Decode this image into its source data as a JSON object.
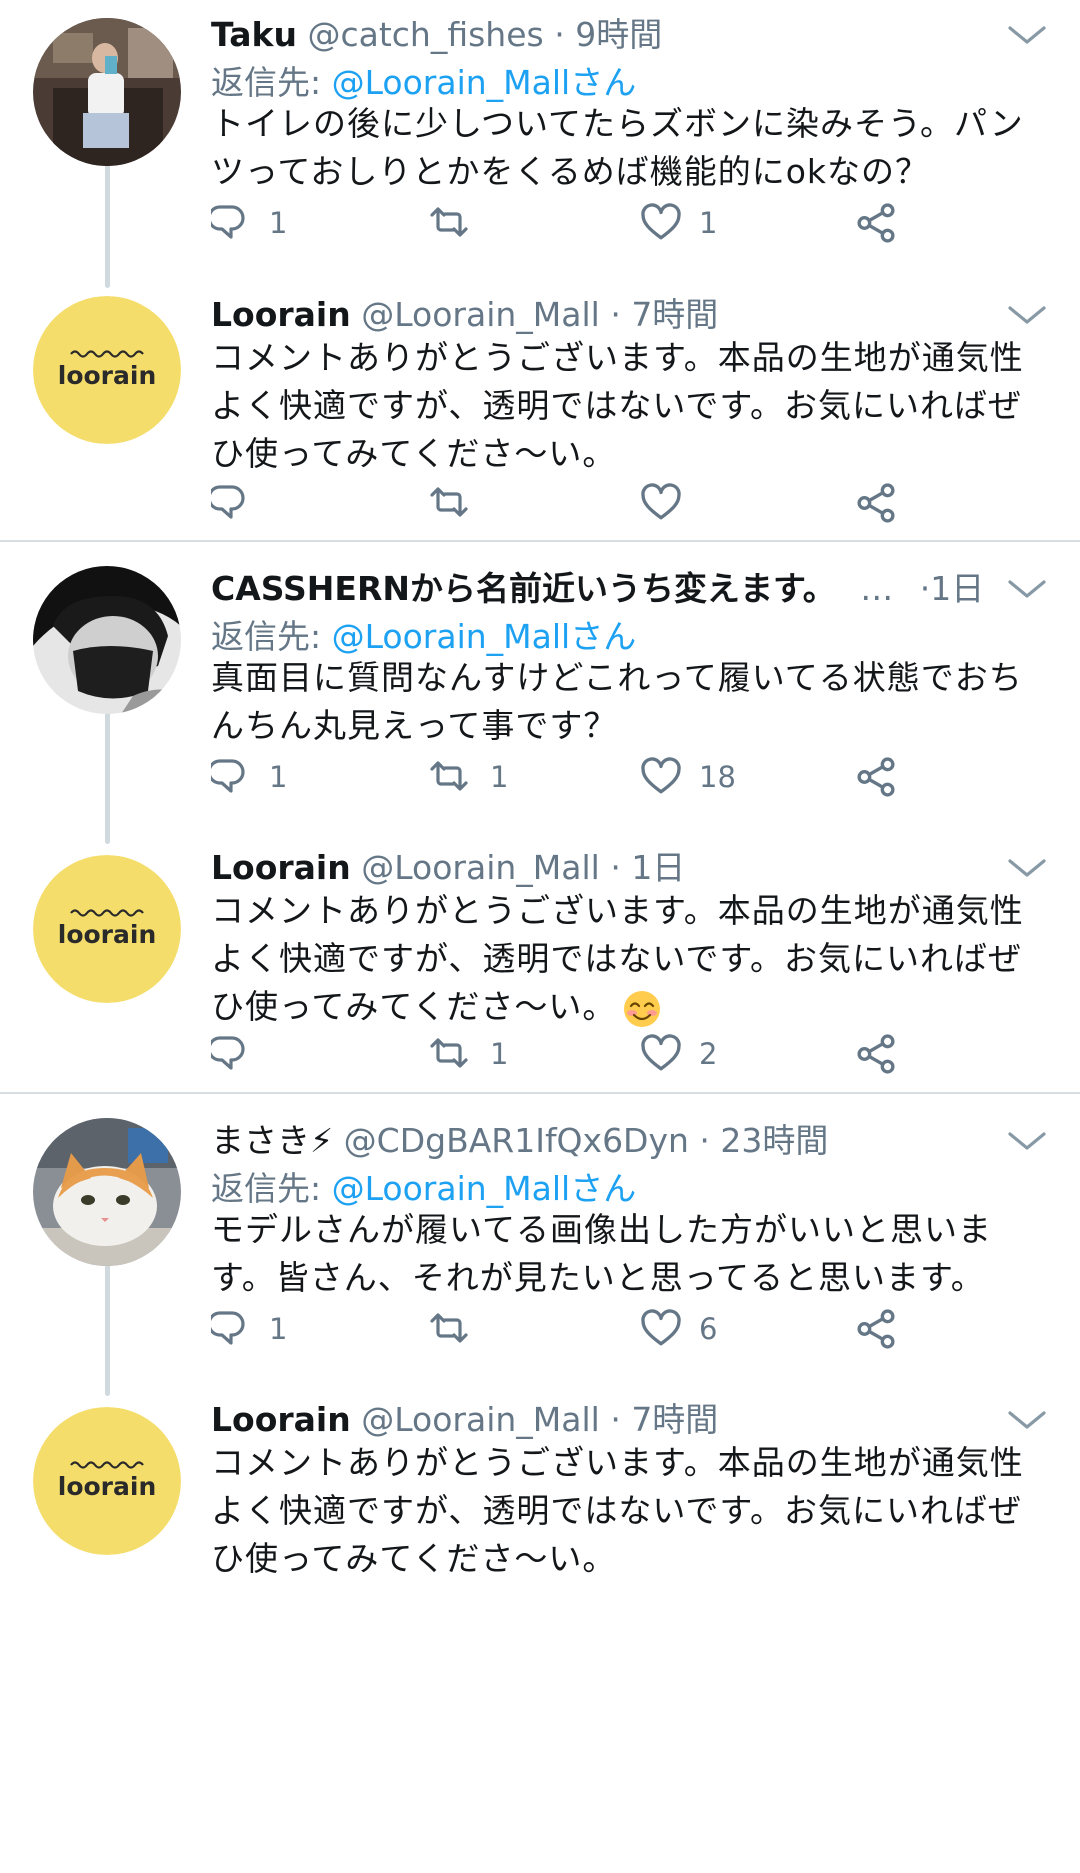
{
  "threads": [
    {
      "parent": {
        "name": "Taku",
        "handle": "@catch_fishes",
        "time": "9時間",
        "reply_label": "返信先: ",
        "reply_mention": "@Loorain_Mallさん",
        "text": "トイレの後に少しついてたらズボンに染みそう。パンツっておしりとかをくるめば機能的にokなの？",
        "reply_count": "1",
        "retweet_count": "",
        "like_count": "1"
      },
      "reply": {
        "name": "Loorain",
        "handle": "@Loorain_Mall",
        "time": "7時間",
        "text": "コメントありがとうございます。本品の生地が通気性よく快適ですが、透明ではないです。お気にいればぜひ使ってみてくださ〜い。",
        "reply_count": "",
        "retweet_count": "",
        "like_count": ""
      }
    },
    {
      "parent": {
        "name": "CASSHERNから名前近いうち変えます。",
        "ellipsis": "…",
        "time": "1日",
        "reply_label": "返信先: ",
        "reply_mention": "@Loorain_Mallさん",
        "text": "真面目に質問なんすけどこれって履いてる状態でおちんちん丸見えって事です？",
        "reply_count": "1",
        "retweet_count": "1",
        "like_count": "18"
      },
      "reply": {
        "name": "Loorain",
        "handle": "@Loorain_Mall",
        "time": "1日",
        "text": "コメントありがとうございます。本品の生地が通気性よく快適ですが、透明ではないです。お気にいればぜひ使ってみてくださ〜い。",
        "reply_count": "",
        "retweet_count": "1",
        "like_count": "2"
      }
    },
    {
      "parent": {
        "name": "まさき⚡",
        "handle": "@CDgBAR1IfQx6Dyn",
        "time": "23時間",
        "reply_label": "返信先: ",
        "reply_mention": "@Loorain_Mallさん",
        "text": "モデルさんが履いてる画像出した方がいいと思います。皆さん、それが見たいと思ってると思います。",
        "reply_count": "1",
        "retweet_count": "",
        "like_count": "6"
      },
      "reply": {
        "name": "Loorain",
        "handle": "@Loorain_Mall",
        "time": "7時間",
        "text": "コメントありがとうございます。本品の生地が通気性よく快適ですが、透明ではないです。お気にいればぜひ使ってみてくださ〜い。"
      }
    }
  ],
  "dot": "·",
  "logo_text": "loorain",
  "colors": {
    "accent": "#1da1f2",
    "secondary_text": "#657786",
    "primary_text": "#14171a",
    "logo_yellow": "#f5dd6b",
    "connector": "#cfd9de",
    "divider": "#d8dde1"
  },
  "icons": [
    "reply-icon",
    "retweet-icon",
    "like-icon",
    "share-icon",
    "chevron-down-icon",
    "smiling-face-emoji"
  ]
}
